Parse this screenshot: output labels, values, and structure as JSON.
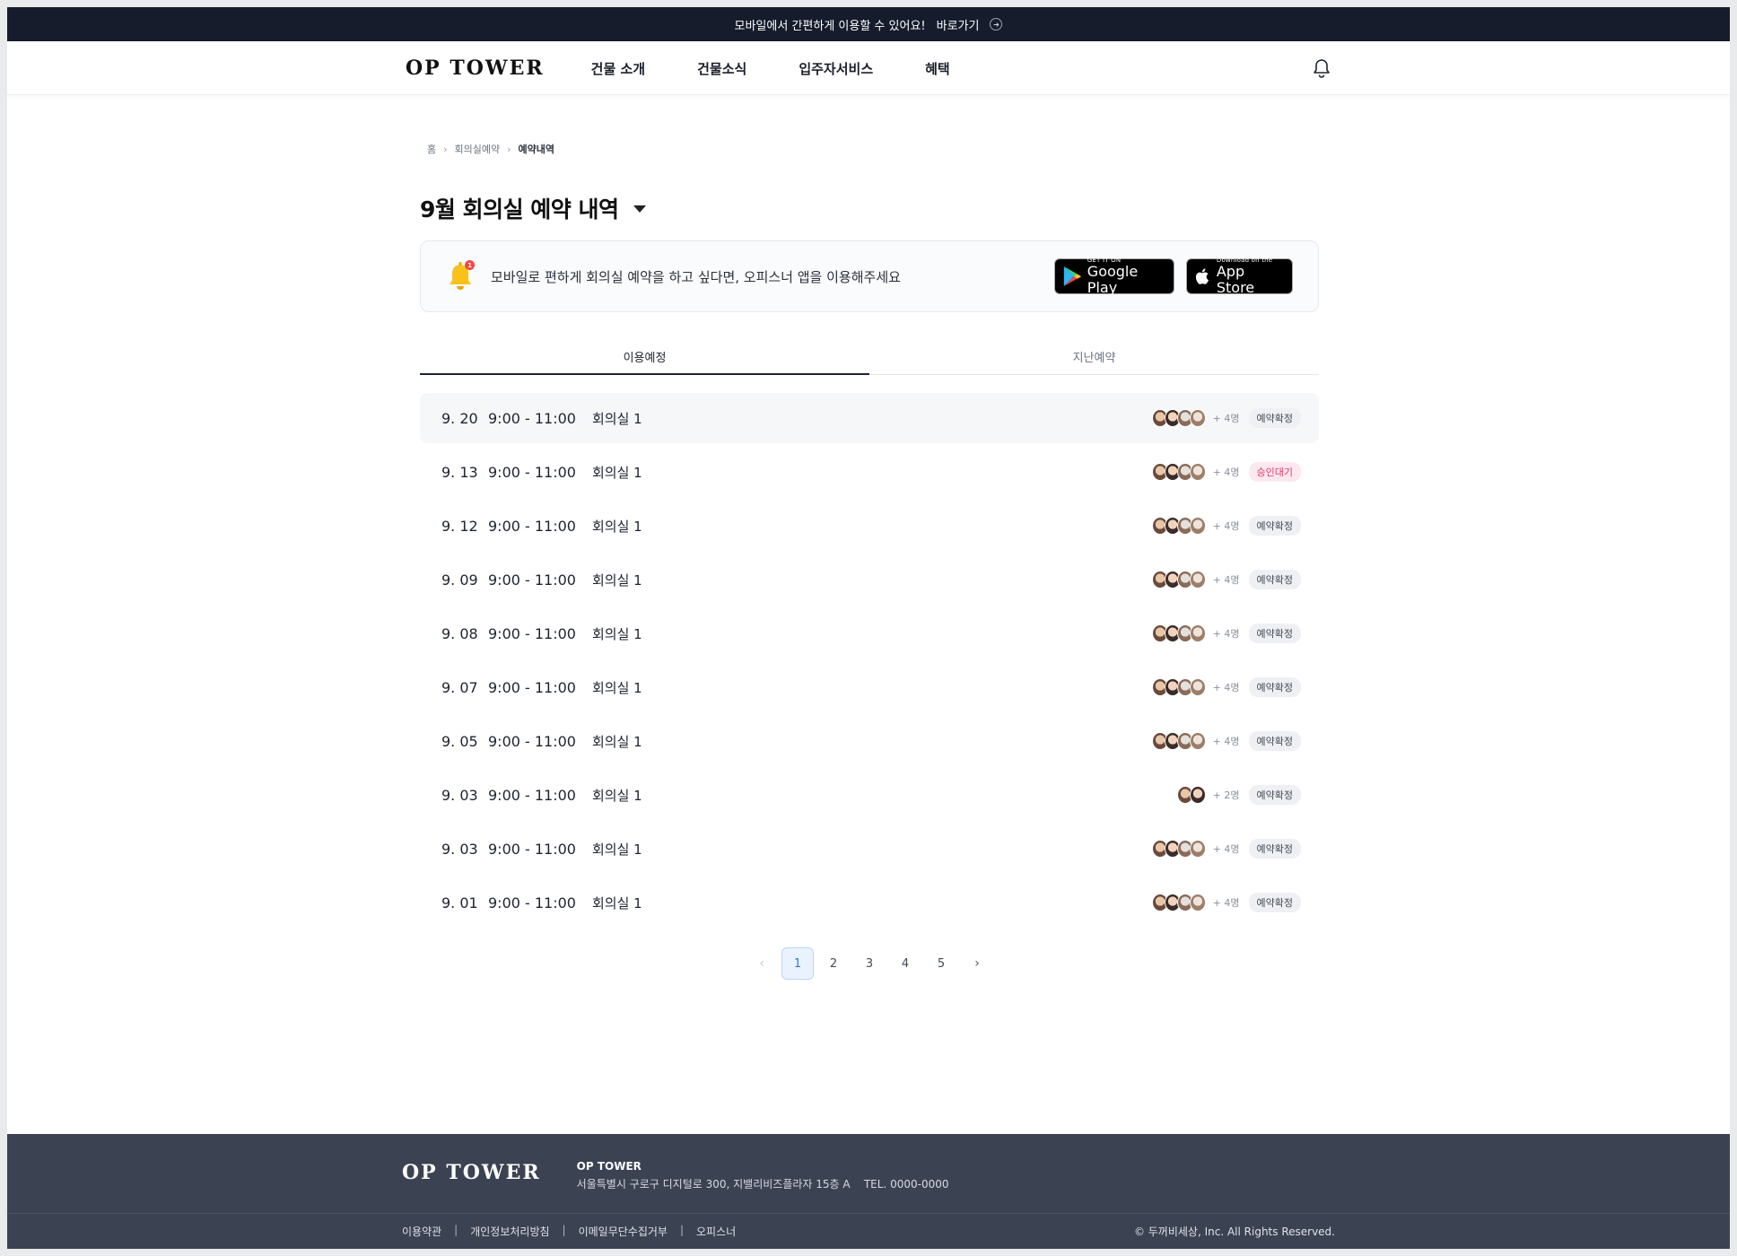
{
  "banner": {
    "text": "모바일에서 간편하게 이용할 수 있어요!",
    "link": "바로가기"
  },
  "header": {
    "logo": "OP TOWER",
    "nav": [
      "건물 소개",
      "건물소식",
      "입주자서비스",
      "혜택"
    ]
  },
  "breadcrumb": [
    "홈",
    "회의실예약",
    "예약내역"
  ],
  "title": "9월 회의실 예약 내역",
  "notice": {
    "badge": "1",
    "text": "모바일로 편하게 회의실 예약을 하고 싶다면, 오피스너 앱을 이용해주세요",
    "google": {
      "small": "GET IT ON",
      "big": "Google Play"
    },
    "apple": {
      "small": "Download on the",
      "big": "App Store"
    }
  },
  "tabs": [
    "이용예정",
    "지난예약"
  ],
  "reservations": [
    {
      "date": "9. 20",
      "time": "9:00 - 11:00",
      "room": "회의실 1",
      "count": "+ 4명",
      "status": "예약확정"
    },
    {
      "date": "9. 13",
      "time": "9:00 - 11:00",
      "room": "회의실 1",
      "count": "+ 4명",
      "status": "승인대기"
    },
    {
      "date": "9. 12",
      "time": "9:00 - 11:00",
      "room": "회의실 1",
      "count": "+ 4명",
      "status": "예약확정"
    },
    {
      "date": "9. 09",
      "time": "9:00 - 11:00",
      "room": "회의실 1",
      "count": "+ 4명",
      "status": "예약확정"
    },
    {
      "date": "9. 08",
      "time": "9:00 - 11:00",
      "room": "회의실 1",
      "count": "+ 4명",
      "status": "예약확정"
    },
    {
      "date": "9. 07",
      "time": "9:00 - 11:00",
      "room": "회의실 1",
      "count": "+ 4명",
      "status": "예약확정"
    },
    {
      "date": "9. 05",
      "time": "9:00 - 11:00",
      "room": "회의실 1",
      "count": "+ 4명",
      "status": "예약확정"
    },
    {
      "date": "9. 03",
      "time": "9:00 - 11:00",
      "room": "회의실 1",
      "count": "+ 2명",
      "status": "예약확정"
    },
    {
      "date": "9. 03",
      "time": "9:00 - 11:00",
      "room": "회의실 1",
      "count": "+ 4명",
      "status": "예약확정"
    },
    {
      "date": "9. 01",
      "time": "9:00 - 11:00",
      "room": "회의실 1",
      "count": "+ 4명",
      "status": "예약확정"
    }
  ],
  "pagination": {
    "pages": [
      "1",
      "2",
      "3",
      "4",
      "5"
    ],
    "current": "1"
  },
  "footer": {
    "logo": "OP TOWER",
    "name": "OP TOWER",
    "address": "서울특별시 구로구 디지털로 300, 지밸리비즈플라자 15층 A    TEL. 0000-0000",
    "links": [
      "이용약관",
      "개인정보처리방침",
      "이메일무단수집거부",
      "오피스너"
    ],
    "copyright": "© 두꺼비세상, Inc. All Rights Reserved."
  }
}
